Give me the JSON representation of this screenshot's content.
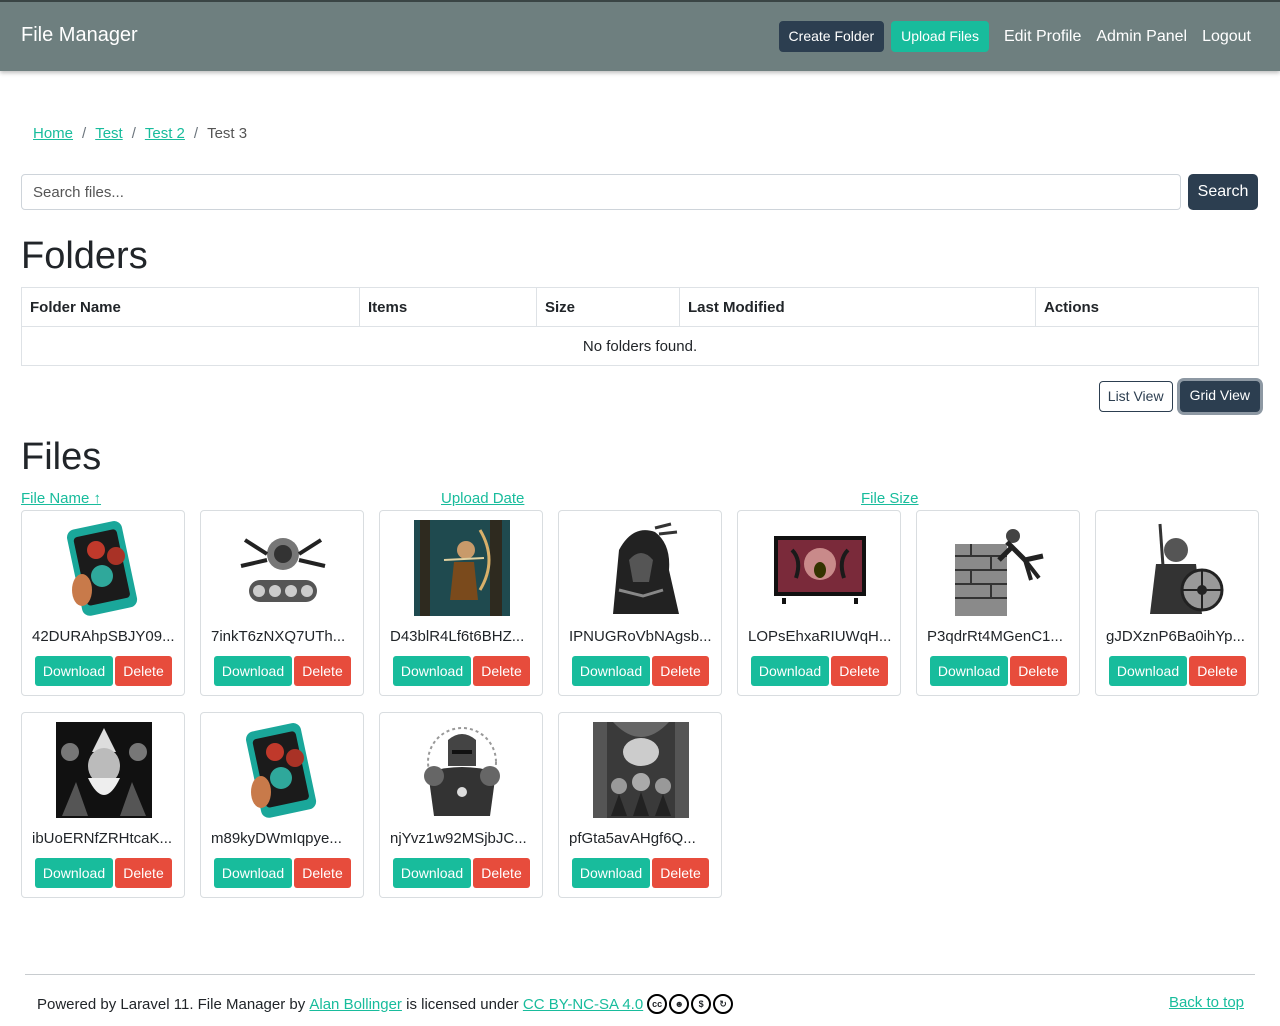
{
  "navbar": {
    "brand": "File Manager",
    "create_folder": "Create Folder",
    "upload_files": "Upload Files",
    "links": [
      "Edit Profile",
      "Admin Panel",
      "Logout"
    ]
  },
  "breadcrumb": {
    "items": [
      "Home",
      "Test",
      "Test 2"
    ],
    "current": "Test 3",
    "separator": "/"
  },
  "search": {
    "placeholder": "Search files...",
    "button": "Search"
  },
  "folders": {
    "heading": "Folders",
    "columns": [
      "Folder Name",
      "Items",
      "Size",
      "Last Modified",
      "Actions"
    ],
    "empty_message": "No folders found."
  },
  "view_toggle": {
    "list": "List View",
    "grid": "Grid View",
    "active": "grid"
  },
  "files": {
    "heading": "Files",
    "sort": {
      "name": "File Name ↑",
      "date": "Upload Date",
      "size": "File Size"
    },
    "download_label": "Download",
    "delete_label": "Delete",
    "items": [
      {
        "name": "42DURAhpSBJY09...",
        "thumb": "phone-demons-icon"
      },
      {
        "name": "7inkT6zNXQ7UTh...",
        "thumb": "spider-tank-icon"
      },
      {
        "name": "D43blR4Lf6t6BHZ...",
        "thumb": "archer-forest-icon"
      },
      {
        "name": "IPNUGRoVbNAgsb...",
        "thumb": "hooded-rogue-icon"
      },
      {
        "name": "LOPsEhxaRIUWqH...",
        "thumb": "tv-monster-icon"
      },
      {
        "name": "P3qdrRt4MGenC1...",
        "thumb": "wall-climber-icon"
      },
      {
        "name": "gJDXznP6Ba0ihYp...",
        "thumb": "viking-shield-icon"
      },
      {
        "name": "ibUoERNfZRHtcaK...",
        "thumb": "dark-wizard-icon"
      },
      {
        "name": "m89kyDWmIqpye...",
        "thumb": "phone-demons-icon"
      },
      {
        "name": "njYvz1w92MSjbJC...",
        "thumb": "armored-knight-icon"
      },
      {
        "name": "pfGta5avAHgf6Q...",
        "thumb": "dungeon-goblins-icon"
      }
    ]
  },
  "footer": {
    "text_before": "Powered by Laravel 11. File Manager by",
    "author": "Alan Bollinger",
    "text_middle": "is licensed under",
    "license": "CC BY-NC-SA 4.0",
    "license_icons": [
      "cc-icon",
      "by-icon",
      "nc-icon",
      "sa-icon"
    ],
    "back_to_top": "Back to top"
  },
  "colors": {
    "navbar": "#6e7f7f",
    "primary_dark": "#2c3e50",
    "accent": "#18bc9c",
    "danger": "#e74c3c"
  }
}
